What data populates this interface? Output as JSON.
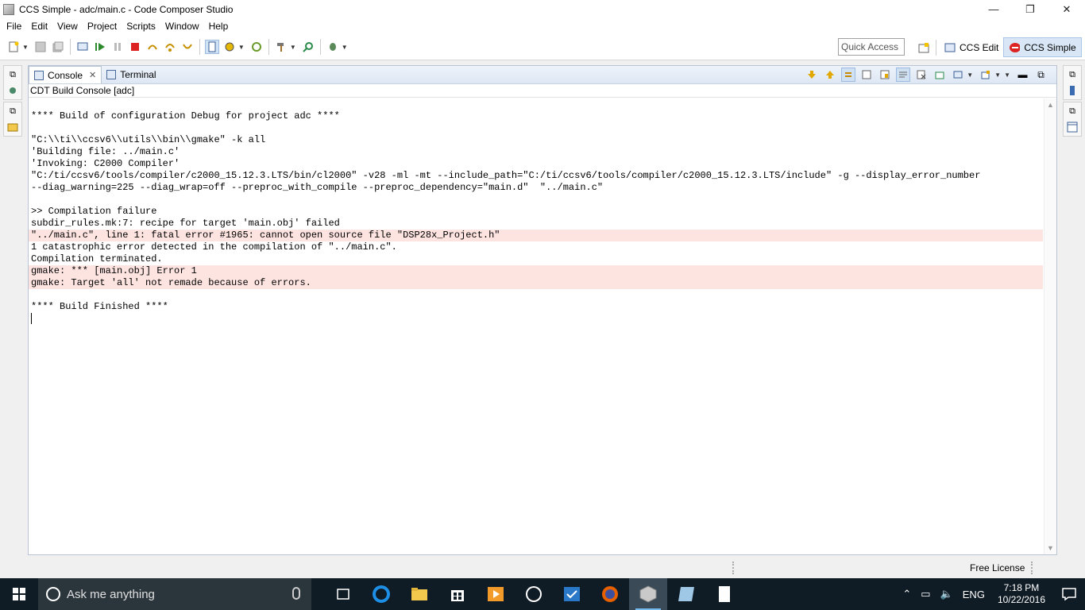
{
  "window": {
    "title": "CCS Simple - adc/main.c - Code Composer Studio",
    "minimize": "—",
    "maximize": "❐",
    "close": "✕"
  },
  "menu": [
    "File",
    "Edit",
    "View",
    "Project",
    "Scripts",
    "Window",
    "Help"
  ],
  "toolbar": {
    "quick_access": "Quick Access",
    "perspectives": [
      {
        "label": "CCS Edit",
        "active": false
      },
      {
        "label": "CCS Simple",
        "active": true
      }
    ]
  },
  "view": {
    "tabs": [
      {
        "label": "Console",
        "active": true
      },
      {
        "label": "Terminal",
        "active": false
      }
    ],
    "console_title": "CDT Build Console [adc]",
    "lines": [
      {
        "text": "**** Build of configuration Debug for project adc ****",
        "error": false
      },
      {
        "text": "",
        "error": false
      },
      {
        "text": "\"C:\\\\ti\\\\ccsv6\\\\utils\\\\bin\\\\gmake\" -k all",
        "error": false
      },
      {
        "text": "'Building file: ../main.c'",
        "error": false
      },
      {
        "text": "'Invoking: C2000 Compiler'",
        "error": false
      },
      {
        "text": "\"C:/ti/ccsv6/tools/compiler/c2000_15.12.3.LTS/bin/cl2000\" -v28 -ml -mt --include_path=\"C:/ti/ccsv6/tools/compiler/c2000_15.12.3.LTS/include\" -g --display_error_number",
        "error": false
      },
      {
        "text": "--diag_warning=225 --diag_wrap=off --preproc_with_compile --preproc_dependency=\"main.d\"  \"../main.c\"",
        "error": false
      },
      {
        "text": "",
        "error": false
      },
      {
        "text": ">> Compilation failure",
        "error": false
      },
      {
        "text": "subdir_rules.mk:7: recipe for target 'main.obj' failed",
        "error": false
      },
      {
        "text": "\"../main.c\", line 1: fatal error #1965: cannot open source file \"DSP28x_Project.h\"",
        "error": true
      },
      {
        "text": "1 catastrophic error detected in the compilation of \"../main.c\".",
        "error": false
      },
      {
        "text": "Compilation terminated.",
        "error": false
      },
      {
        "text": "gmake: *** [main.obj] Error 1",
        "error": true
      },
      {
        "text": "gmake: Target 'all' not remade because of errors.",
        "error": true
      },
      {
        "text": "",
        "error": false
      },
      {
        "text": "**** Build Finished ****",
        "error": false
      }
    ]
  },
  "status": {
    "license": "Free License"
  },
  "taskbar": {
    "search_placeholder": "Ask me anything",
    "language": "ENG",
    "time": "7:18 PM",
    "date": "10/22/2016"
  },
  "colors": {
    "error_highlight": "#fde4e1",
    "taskbar": "#101c25",
    "accent": "#76b9ed"
  }
}
